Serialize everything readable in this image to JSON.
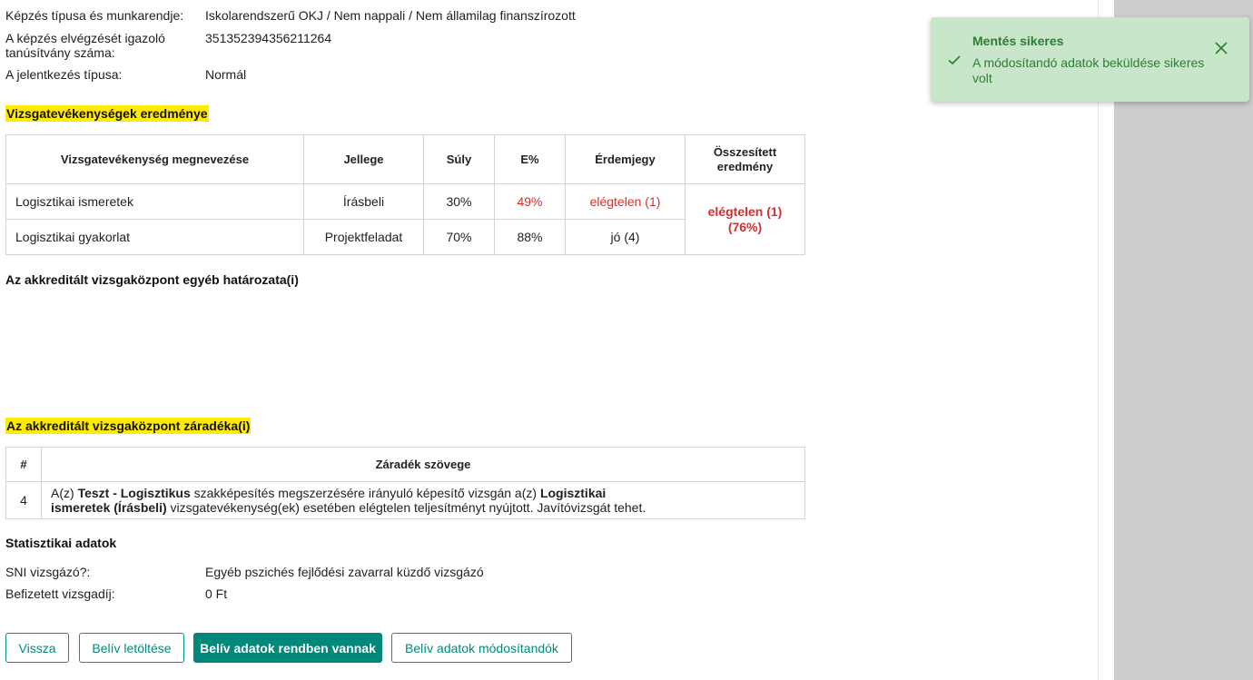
{
  "info": [
    {
      "label": "Képzés típusa és munkarendje:",
      "value": "Iskolarendszerű OKJ / Nem nappali / Nem államilag finanszírozott"
    },
    {
      "label": "A képzés elvégzését igazoló tanúsítvány száma:",
      "value": "351352394356211264"
    },
    {
      "label": "A jelentkezés típusa:",
      "value": "Normál"
    }
  ],
  "results": {
    "heading": "Vizsgatevékenységek eredménye",
    "headers": [
      "Vizsgatevékenység megnevezése",
      "Jellege",
      "Súly",
      "E%",
      "Érdemjegy",
      "Összesített eredmény"
    ],
    "rows": [
      {
        "name": "Logisztikai ismeretek",
        "type": "Írásbeli",
        "weight": "30%",
        "percent": "49%",
        "grade": "elégtelen (1)"
      },
      {
        "name": "Logisztikai gyakorlat",
        "type": "Projektfeladat",
        "weight": "70%",
        "percent": "88%",
        "grade": "jó (4)"
      }
    ],
    "total": "elégtelen (1) (76%)"
  },
  "other_decisions": {
    "heading": "Az akkreditált vizsgaközpont egyéb határozata(i)"
  },
  "clauses": {
    "heading": "Az akkreditált vizsgaközpont záradéka(i)",
    "headers": [
      "#",
      "Záradék szövege"
    ],
    "row": {
      "num": "4",
      "t1": "A(z) ",
      "b1": "Teszt - Logisztikus",
      "t2": " szakképesítés megszerzésére irányuló képesítő vizsgán a(z) ",
      "b2": "Logisztikai ismeretek (Írásbeli)",
      "t3": " vizsgatevékenység(ek) esetében elégtelen teljesítményt nyújtott. Javítóvizsgát tehet."
    }
  },
  "stats": {
    "heading": "Statisztikai adatok",
    "items": [
      {
        "label": "SNI vizsgázó?:",
        "value": "Egyéb pszichés fejlődési zavarral küzdő vizsgázó"
      },
      {
        "label": "Befizetett vizsgadíj:",
        "value": "0 Ft"
      }
    ]
  },
  "buttons": {
    "back": "Vissza",
    "download": "Belív letöltése",
    "ok": "Belív adatok rendben vannak",
    "modify": "Belív adatok módosítandók"
  },
  "toast": {
    "title": "Mentés sikeres",
    "message": "A módosítandó adatok beküldése sikeres volt",
    "icon": "check-icon",
    "close_icon": "close-icon"
  },
  "colors": {
    "accent": "#00897b",
    "highlight": "#ffeb00",
    "error": "#d32f2f",
    "toast_bg": "#c8e6c9",
    "toast_text": "#2e7d32"
  }
}
